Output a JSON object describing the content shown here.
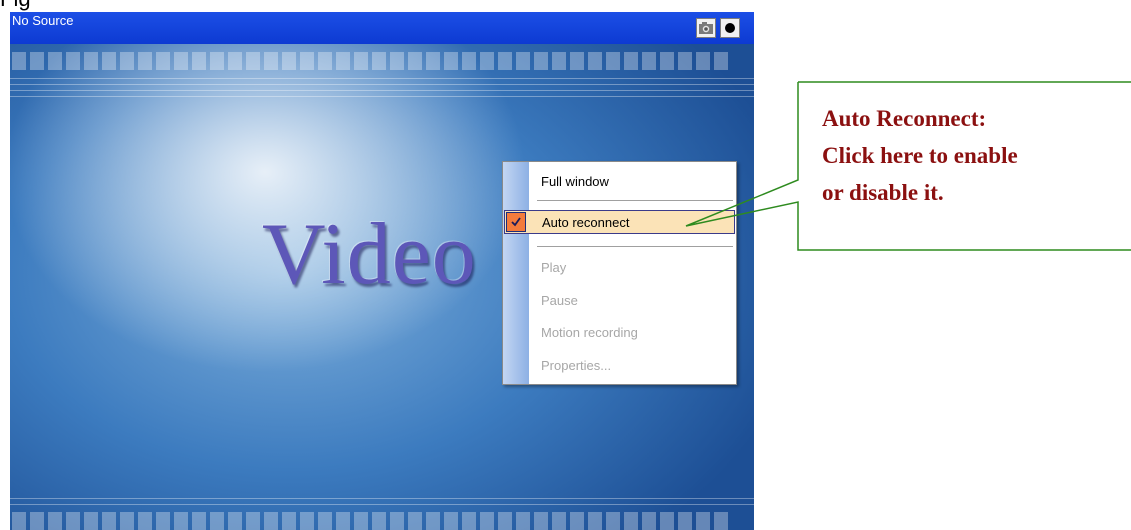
{
  "fragment": "Fig",
  "viewer": {
    "title": "No Source",
    "logo_text": "Video",
    "toolbar": {
      "snapshot_icon": "camera-icon",
      "record_icon": "record-dot-icon"
    }
  },
  "context_menu": {
    "items": [
      {
        "label": "Full window",
        "enabled": true,
        "checked": false
      },
      {
        "label": "Auto reconnect",
        "enabled": true,
        "checked": true
      },
      {
        "label": "Play",
        "enabled": false,
        "checked": false
      },
      {
        "label": "Pause",
        "enabled": false,
        "checked": false
      },
      {
        "label": "Motion recording",
        "enabled": false,
        "checked": false
      },
      {
        "label": "Properties...",
        "enabled": false,
        "checked": false
      }
    ]
  },
  "callout": {
    "line1": "Auto Reconnect:",
    "line2": "Click here to enable",
    "line3": "or disable it.",
    "border_color": "#2e8b1f",
    "text_color": "#8b1010"
  },
  "colors": {
    "titlebar": "#0d3ad2",
    "checkbox_fill": "#f47b3c",
    "selected_row": "#fbe3b7"
  }
}
